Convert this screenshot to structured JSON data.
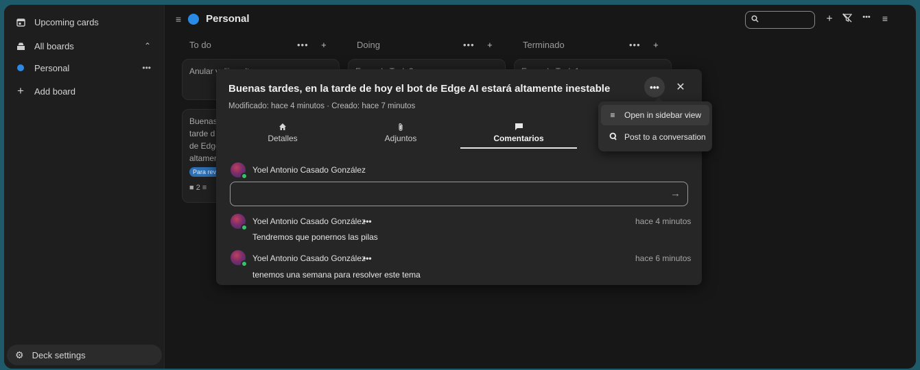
{
  "sidebar": {
    "upcoming": "Upcoming cards",
    "all_boards": "All boards",
    "board_personal": "Personal",
    "add_board": "Add board",
    "deck_settings": "Deck settings"
  },
  "header": {
    "board_title": "Personal",
    "search_value": ""
  },
  "columns": [
    {
      "title": "To do"
    },
    {
      "title": "Doing"
    },
    {
      "title": "Terminado"
    }
  ],
  "cards": {
    "todo_first": "Anular valijas alternas",
    "doing_first": "Example Task 2",
    "done_first": "Example Task 1",
    "todo_second_lines": [
      "Buenas",
      "tarde d",
      "de Edge",
      "altamer"
    ],
    "todo_second_tag": "Para revi",
    "todo_second_counts": "2"
  },
  "modal": {
    "title": "Buenas tardes, en la tarde de hoy el bot de Edge AI estará altamente inestable",
    "subtitle": "Modificado: hace 4 minutos · Creado: hace 7 minutos",
    "tabs": [
      "Detalles",
      "Adjuntos",
      "Comentarios"
    ],
    "current_user": "Yoel Antonio Casado González",
    "input_value": "",
    "comments": [
      {
        "author": "Yoel Antonio Casado González",
        "time": "hace 4 minutos",
        "text": "Tendremos que ponernos las pilas"
      },
      {
        "author": "Yoel Antonio Casado González",
        "time": "hace 6 minutos",
        "text": "tenemos una semana para resolver este tema"
      }
    ]
  },
  "menu": {
    "items": [
      "Open in sidebar view",
      "Post to a conversation"
    ]
  },
  "colors": {
    "accent_blue": "#2a8be6",
    "online_green": "#37c36e",
    "background": "#171717"
  }
}
